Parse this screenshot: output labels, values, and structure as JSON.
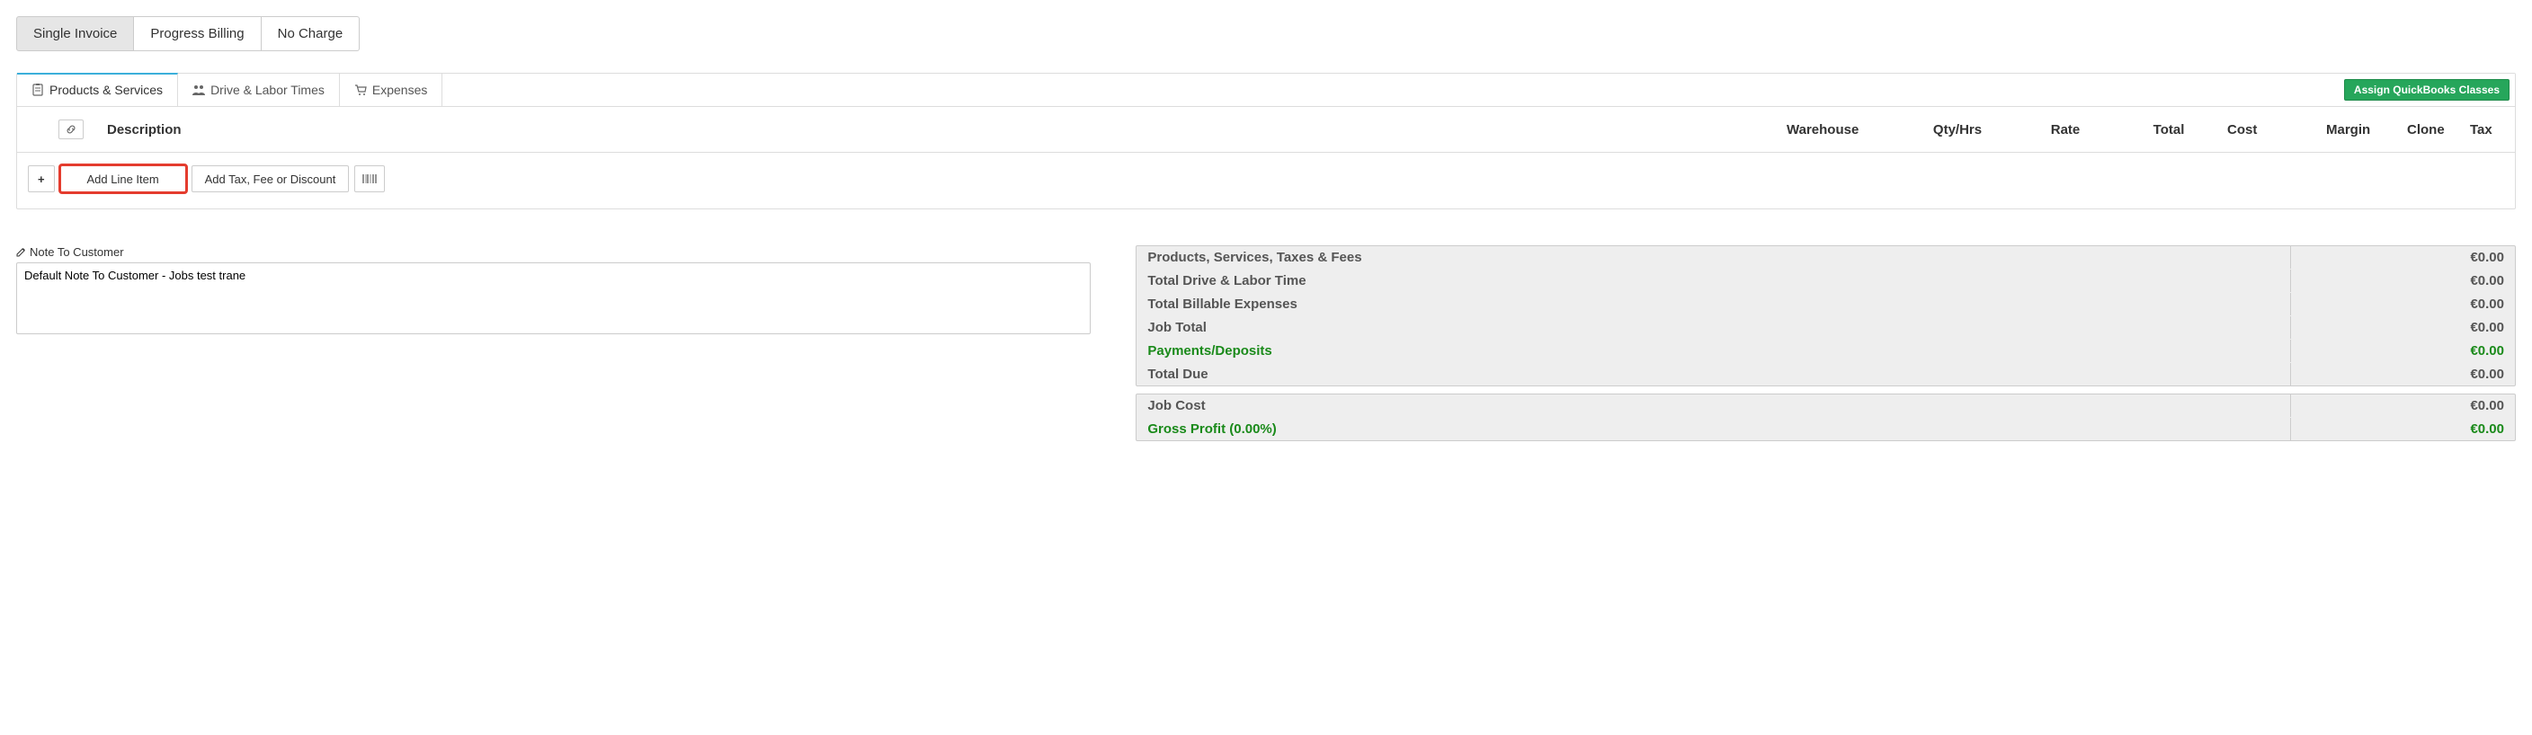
{
  "top_buttons": {
    "single_invoice": "Single Invoice",
    "progress_billing": "Progress Billing",
    "no_charge": "No Charge"
  },
  "tabs": {
    "products": "Products & Services",
    "drive_labor": "Drive & Labor Times",
    "expenses": "Expenses"
  },
  "assign_qb": "Assign QuickBooks Classes",
  "columns": {
    "description": "Description",
    "warehouse": "Warehouse",
    "qty": "Qty/Hrs",
    "rate": "Rate",
    "total": "Total",
    "cost": "Cost",
    "margin": "Margin",
    "clone": "Clone",
    "tax": "Tax"
  },
  "actions": {
    "add_line_item": "Add Line Item",
    "add_tax": "Add Tax, Fee or Discount"
  },
  "note": {
    "label": "Note To Customer",
    "value": "Default Note To Customer - Jobs test trane"
  },
  "totals": {
    "group1": [
      {
        "label": "Products, Services, Taxes & Fees",
        "value": "€0.00",
        "green": false
      },
      {
        "label": "Total Drive & Labor Time",
        "value": "€0.00",
        "green": false
      },
      {
        "label": "Total Billable Expenses",
        "value": "€0.00",
        "green": false
      },
      {
        "label": "Job Total",
        "value": "€0.00",
        "green": false
      },
      {
        "label": "Payments/Deposits",
        "value": "€0.00",
        "green": true
      },
      {
        "label": "Total Due",
        "value": "€0.00",
        "green": false
      }
    ],
    "group2": [
      {
        "label": "Job Cost",
        "value": "€0.00",
        "green": false
      },
      {
        "label": "Gross Profit (0.00%)",
        "value": "€0.00",
        "green": true
      }
    ]
  }
}
